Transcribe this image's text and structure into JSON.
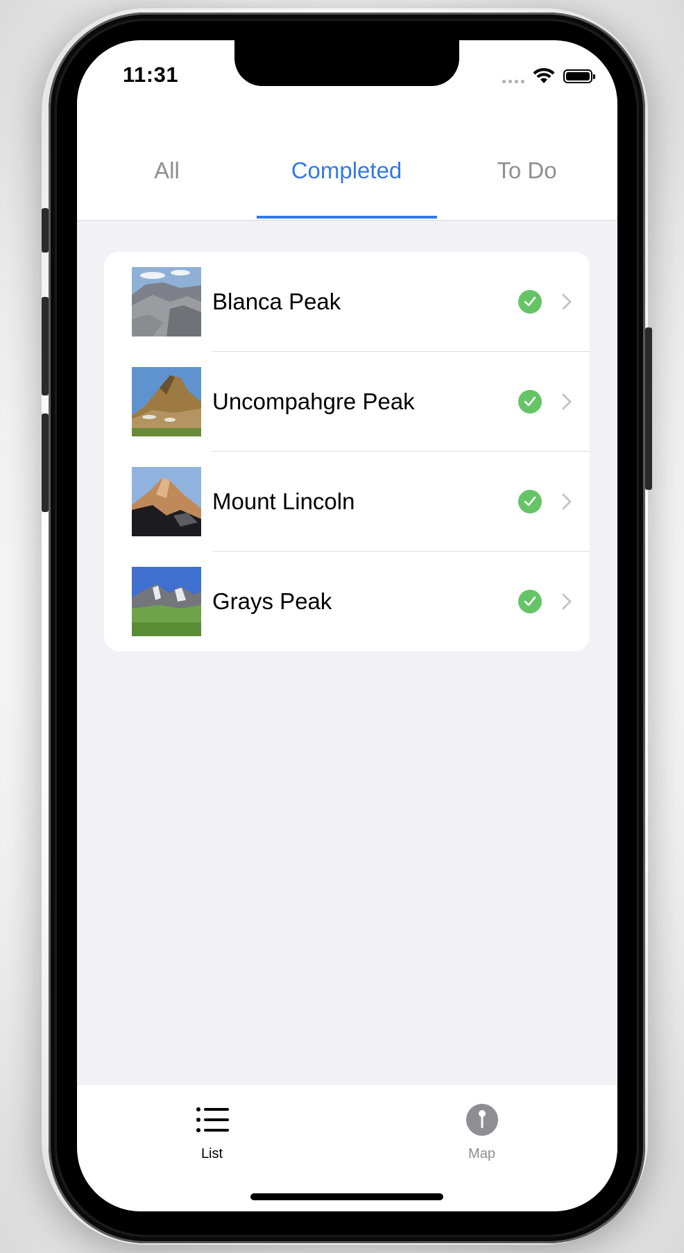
{
  "status_bar": {
    "time": "11:31"
  },
  "segments": {
    "items": [
      {
        "label": "All"
      },
      {
        "label": "Completed"
      },
      {
        "label": "To Do"
      }
    ],
    "active": "Completed",
    "accent_color": "#3478e5"
  },
  "peaks": [
    {
      "name": "Blanca Peak",
      "completed": true
    },
    {
      "name": "Uncompahgre Peak",
      "completed": true
    },
    {
      "name": "Mount Lincoln",
      "completed": true
    },
    {
      "name": "Grays Peak",
      "completed": true
    }
  ],
  "tab_bar": {
    "items": [
      {
        "label": "List",
        "icon": "list-icon",
        "selected": true
      },
      {
        "label": "Map",
        "icon": "map-pin-icon",
        "selected": false
      }
    ]
  },
  "colors": {
    "check": "#64c466",
    "inactive": "#8e8e93"
  }
}
